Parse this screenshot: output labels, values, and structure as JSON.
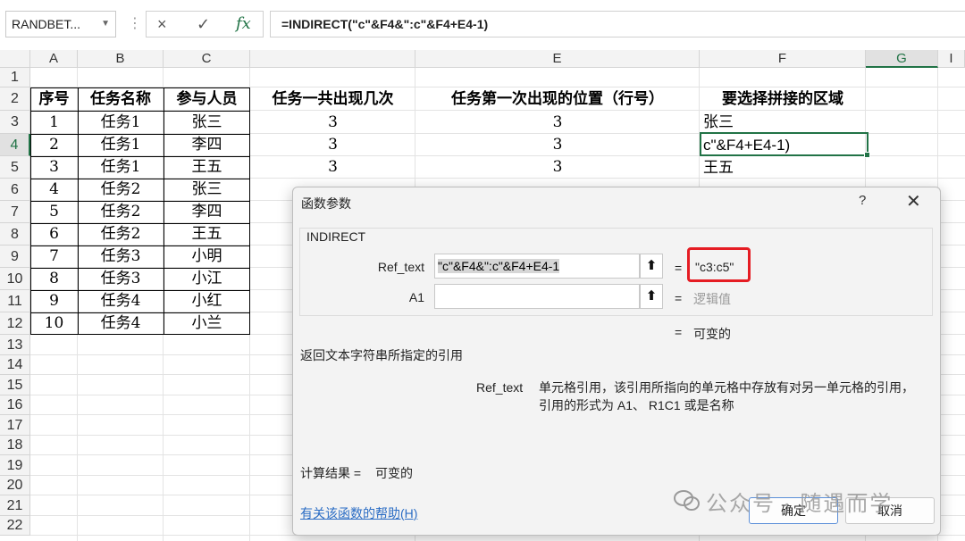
{
  "formula_bar": {
    "name_box": "RANDBET...",
    "cancel_icon": "×",
    "enter_icon": "✓",
    "fx_icon": "fx",
    "formula": "=INDIRECT(\"c\"&F4&\":c\"&F4+E4-1)"
  },
  "columns": [
    "A",
    "B",
    "C",
    "",
    "E",
    "F",
    "G",
    "I"
  ],
  "selected_column": "G",
  "rows": [
    "1",
    "2",
    "3",
    "4",
    "5",
    "6",
    "7",
    "8",
    "9",
    "10",
    "11",
    "12",
    "13",
    "14",
    "15",
    "16",
    "17",
    "18",
    "19",
    "20",
    "21",
    "22"
  ],
  "selected_row": "4",
  "table": {
    "headers": [
      "序号",
      "任务名称",
      "参与人员",
      "任务一共出现几次",
      "任务第一次出现的位置（行号）",
      "要选择拼接的区域"
    ],
    "rows": [
      [
        "1",
        "任务1",
        "张三",
        "3",
        "3",
        "张三"
      ],
      [
        "2",
        "任务1",
        "李四",
        "3",
        "3",
        "c\"&F4+E4-1)"
      ],
      [
        "3",
        "任务1",
        "王五",
        "3",
        "3",
        "王五"
      ],
      [
        "4",
        "任务2",
        "张三",
        "",
        "",
        ""
      ],
      [
        "5",
        "任务2",
        "李四",
        "",
        "",
        ""
      ],
      [
        "6",
        "任务2",
        "王五",
        "",
        "",
        ""
      ],
      [
        "7",
        "任务3",
        "小明",
        "",
        "",
        ""
      ],
      [
        "8",
        "任务3",
        "小江",
        "",
        "",
        ""
      ],
      [
        "9",
        "任务4",
        "小红",
        "",
        "",
        ""
      ],
      [
        "10",
        "任务4",
        "小兰",
        "",
        "",
        ""
      ]
    ]
  },
  "dialog": {
    "title": "函数参数",
    "help": "?",
    "close": "✕",
    "function_name": "INDIRECT",
    "args": [
      {
        "label": "Ref_text",
        "value": "\"c\"&F4&\":c\"&F4+E4-1",
        "result": "\"c3:c5\""
      },
      {
        "label": "A1",
        "value": "",
        "result": "逻辑值"
      }
    ],
    "formula_result_line": "可变的",
    "description": "返回文本字符串所指定的引用",
    "arg_desc_name": "Ref_text",
    "arg_desc_line1": "单元格引用，该引用所指向的单元格中存放有对另一单元格的引用，",
    "arg_desc_line2": "引用的形式为 A1、 R1C1 或是名称",
    "calc_result_label": "计算结果 =",
    "calc_result_value": "可变的",
    "help_link": "有关该函数的帮助(H)",
    "ok_label": "确定",
    "cancel_label": "取消"
  },
  "watermark": "公众号 · 随遇而学",
  "accent_color": "#217346",
  "highlight_color": "#e51c23"
}
